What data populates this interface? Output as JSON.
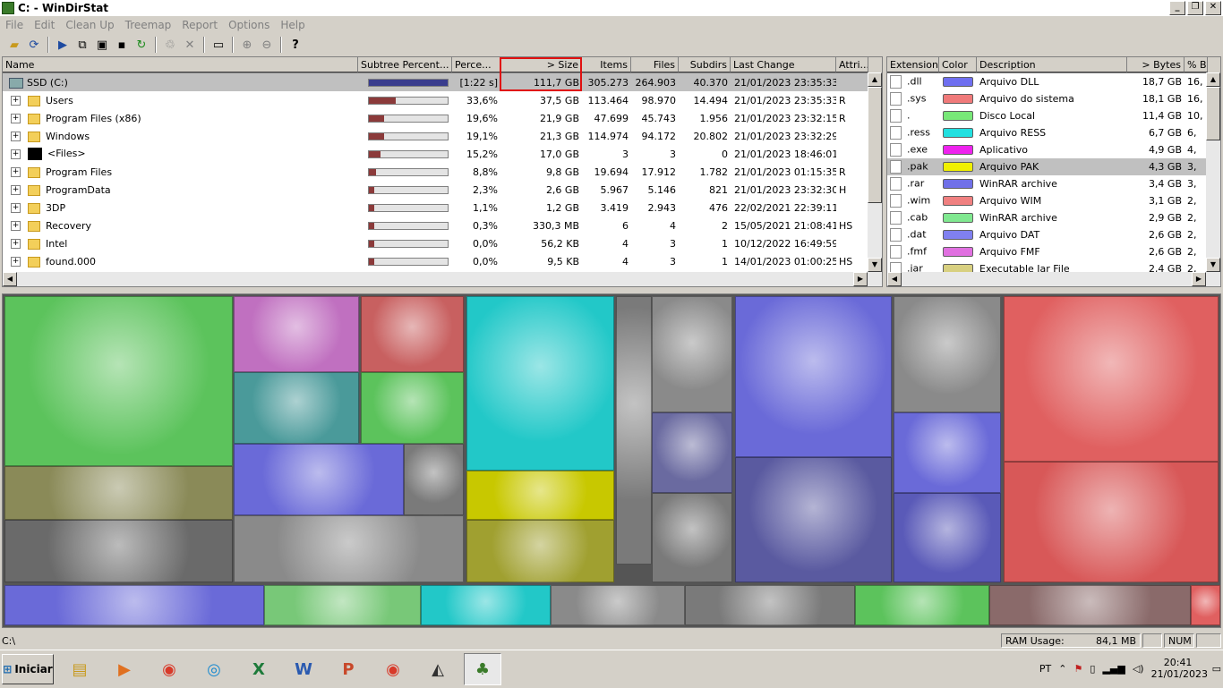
{
  "window": {
    "title": "C: - WinDirStat",
    "min": "_",
    "max": "❐",
    "close": "✕"
  },
  "menu": [
    "File",
    "Edit",
    "Clean Up",
    "Treemap",
    "Report",
    "Options",
    "Help"
  ],
  "dir_columns": [
    "Name",
    "Subtree Percent...",
    "Perce...",
    "> Size",
    "Items",
    "Files",
    "Subdirs",
    "Last Change",
    "Attri..."
  ],
  "dir_rows": [
    {
      "name": "SSD (C:)",
      "pct": 100,
      "perc": "[1:22 s]",
      "size": "111,7 GB",
      "items": "305.273",
      "files": "264.903",
      "subdirs": "40.370",
      "last": "21/01/2023  23:35:33",
      "attr": ""
    },
    {
      "name": "Users",
      "pct": 33.6,
      "perc": "33,6%",
      "size": "37,5 GB",
      "items": "113.464",
      "files": "98.970",
      "subdirs": "14.494",
      "last": "21/01/2023  23:35:33",
      "attr": "R"
    },
    {
      "name": "Program Files (x86)",
      "pct": 19.6,
      "perc": "19,6%",
      "size": "21,9 GB",
      "items": "47.699",
      "files": "45.743",
      "subdirs": "1.956",
      "last": "21/01/2023  23:32:15",
      "attr": "R"
    },
    {
      "name": "Windows",
      "pct": 19.1,
      "perc": "19,1%",
      "size": "21,3 GB",
      "items": "114.974",
      "files": "94.172",
      "subdirs": "20.802",
      "last": "21/01/2023  23:32:29",
      "attr": ""
    },
    {
      "name": "<Files>",
      "pct": 15.2,
      "perc": "15,2%",
      "size": "17,0 GB",
      "items": "3",
      "files": "3",
      "subdirs": "0",
      "last": "21/01/2023  18:46:01",
      "attr": ""
    },
    {
      "name": "Program Files",
      "pct": 8.8,
      "perc": "8,8%",
      "size": "9,8 GB",
      "items": "19.694",
      "files": "17.912",
      "subdirs": "1.782",
      "last": "21/01/2023  01:15:35",
      "attr": "R"
    },
    {
      "name": "ProgramData",
      "pct": 2.3,
      "perc": "2,3%",
      "size": "2,6 GB",
      "items": "5.967",
      "files": "5.146",
      "subdirs": "821",
      "last": "21/01/2023  23:32:30",
      "attr": "H"
    },
    {
      "name": "3DP",
      "pct": 1.1,
      "perc": "1,1%",
      "size": "1,2 GB",
      "items": "3.419",
      "files": "2.943",
      "subdirs": "476",
      "last": "22/02/2021  22:39:11",
      "attr": ""
    },
    {
      "name": "Recovery",
      "pct": 0.3,
      "perc": "0,3%",
      "size": "330,3 MB",
      "items": "6",
      "files": "4",
      "subdirs": "2",
      "last": "15/05/2021  21:08:41",
      "attr": "HS"
    },
    {
      "name": "Intel",
      "pct": 0.0,
      "perc": "0,0%",
      "size": "56,2 KB",
      "items": "4",
      "files": "3",
      "subdirs": "1",
      "last": "10/12/2022  16:49:59",
      "attr": ""
    },
    {
      "name": "found.000",
      "pct": 0.0,
      "perc": "0,0%",
      "size": "9,5 KB",
      "items": "4",
      "files": "3",
      "subdirs": "1",
      "last": "14/01/2023  01:00:25",
      "attr": "HS"
    }
  ],
  "ext_columns": [
    "Extension",
    "Color",
    "Description",
    "> Bytes",
    "% B"
  ],
  "ext_rows": [
    {
      "ext": ".dll",
      "color": "#6f6ff0",
      "desc": "Arquivo DLL",
      "bytes": "18,7 GB",
      "pb": "16,"
    },
    {
      "ext": ".sys",
      "color": "#f07a7a",
      "desc": "Arquivo do sistema",
      "bytes": "18,1 GB",
      "pb": "16,"
    },
    {
      "ext": ".",
      "color": "#78e878",
      "desc": "Disco Local",
      "bytes": "11,4 GB",
      "pb": "10,"
    },
    {
      "ext": ".ress",
      "color": "#22e0e0",
      "desc": "Arquivo RESS",
      "bytes": "6,7 GB",
      "pb": "6,"
    },
    {
      "ext": ".exe",
      "color": "#ee22ee",
      "desc": "Aplicativo",
      "bytes": "4,9 GB",
      "pb": "4,"
    },
    {
      "ext": ".pak",
      "color": "#f0f000",
      "desc": "Arquivo PAK",
      "bytes": "4,3 GB",
      "pb": "3,"
    },
    {
      "ext": ".rar",
      "color": "#7070e8",
      "desc": "WinRAR archive",
      "bytes": "3,4 GB",
      "pb": "3,"
    },
    {
      "ext": ".wim",
      "color": "#f08080",
      "desc": "Arquivo WIM",
      "bytes": "3,1 GB",
      "pb": "2,"
    },
    {
      "ext": ".cab",
      "color": "#80e890",
      "desc": "WinRAR archive",
      "bytes": "2,9 GB",
      "pb": "2,"
    },
    {
      "ext": ".dat",
      "color": "#8080f0",
      "desc": "Arquivo DAT",
      "bytes": "2,6 GB",
      "pb": "2,"
    },
    {
      "ext": ".fmf",
      "color": "#e070e0",
      "desc": "Arquivo FMF",
      "bytes": "2,6 GB",
      "pb": "2,"
    },
    {
      "ext": ".jar",
      "color": "#d8d080",
      "desc": "Executable Jar File",
      "bytes": "2,4 GB",
      "pb": "2,"
    }
  ],
  "status": {
    "path": "C:\\",
    "ram_label": "RAM Usage:",
    "ram_value": "84,1 MB",
    "num": "NUM"
  },
  "taskbar": {
    "start": "Iniciar",
    "lang": "PT",
    "time": "20:41",
    "date": "21/01/2023"
  },
  "colors": {
    "selection": "#c0c0c0",
    "highlight_box": "#e01010",
    "dir_bar": "#8b3a3a",
    "root_bar": "#3a3d8e"
  }
}
